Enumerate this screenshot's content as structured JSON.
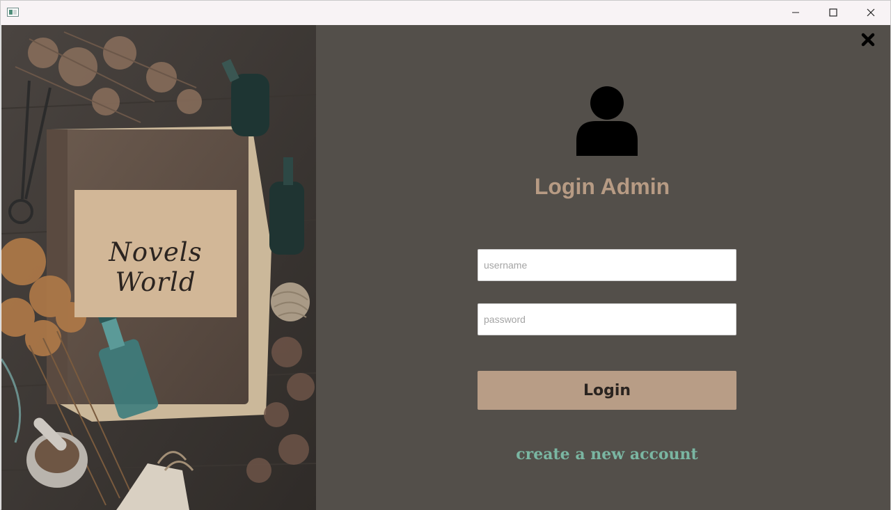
{
  "window": {
    "title": "",
    "controls": {
      "minimize_icon": "minimize-icon",
      "maximize_icon": "maximize-icon",
      "close_icon": "close-icon"
    }
  },
  "hero": {
    "label_text": "Novels World"
  },
  "login": {
    "title": "Login Admin",
    "user_icon": "user-icon",
    "close_icon": "close-x-icon",
    "username": {
      "value": "",
      "placeholder": "username"
    },
    "password": {
      "value": "",
      "placeholder": "password"
    },
    "button_label": "Login",
    "create_account_label": "create a new account"
  },
  "colors": {
    "panel_bg": "#534f4a",
    "title": "#b79b84",
    "button": "#b89d86",
    "link": "#7ab6a2"
  }
}
